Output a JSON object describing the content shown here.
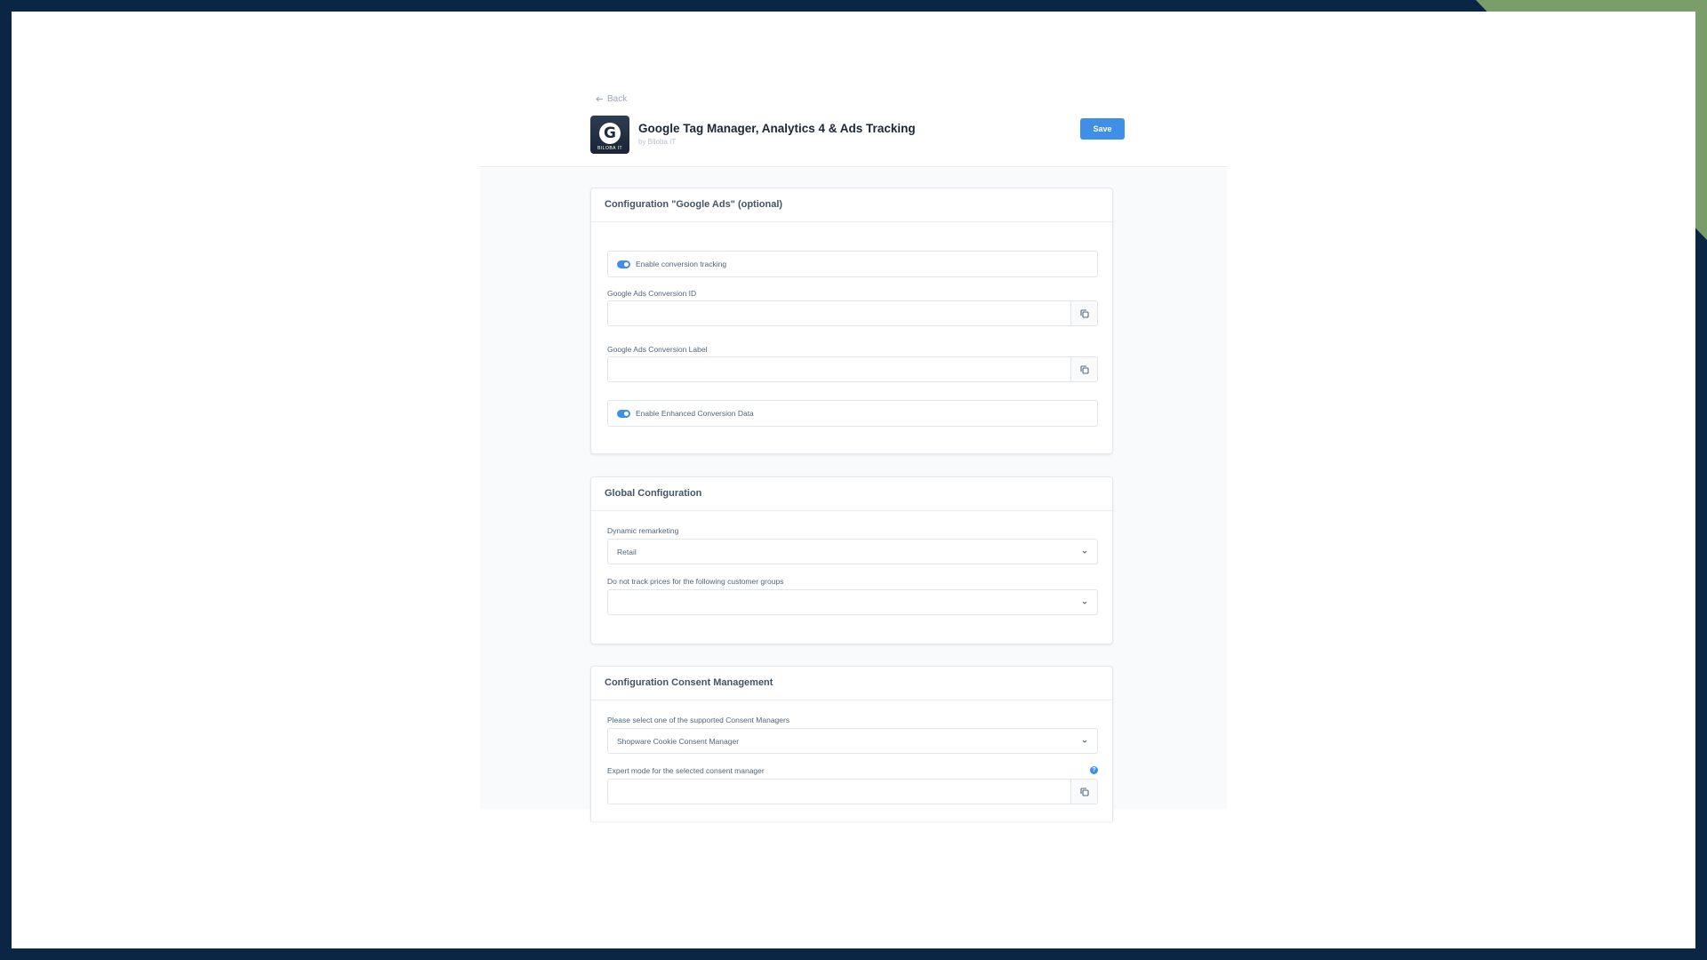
{
  "header": {
    "back_label": "Back",
    "plugin_title": "Google Tag Manager, Analytics 4 & Ads Tracking",
    "plugin_author": "by Biloba IT",
    "logo_letter": "G",
    "logo_caption": "BILOBA IT",
    "save_label": "Save"
  },
  "google_ads": {
    "title": "Configuration \"Google Ads\" (optional)",
    "conversion_tracking_label": "Enable conversion tracking",
    "conversion_tracking_enabled": true,
    "conversion_id_label": "Google Ads Conversion ID",
    "conversion_id_value": "",
    "conversion_label_label": "Google Ads Conversion Label",
    "conversion_label_value": "",
    "enhanced_conversion_label": "Enable Enhanced Conversion Data",
    "enhanced_conversion_enabled": true
  },
  "global_config": {
    "title": "Global Configuration",
    "dynamic_remarketing_label": "Dynamic remarketing",
    "dynamic_remarketing_value": "Retail",
    "customer_groups_label": "Do not track prices for the following customer groups",
    "customer_groups_value": ""
  },
  "consent": {
    "title": "Configuration Consent Management",
    "consent_manager_label": "Please select one of the supported Consent Managers",
    "consent_manager_value": "Shopware Cookie Consent Manager",
    "expert_mode_label": "Expert mode for the selected consent manager",
    "expert_mode_value": "",
    "help_glyph": "?"
  },
  "colors": {
    "accent": "#3f8fe8",
    "frame": "#0b2545",
    "corner": "#7a9e6a"
  }
}
